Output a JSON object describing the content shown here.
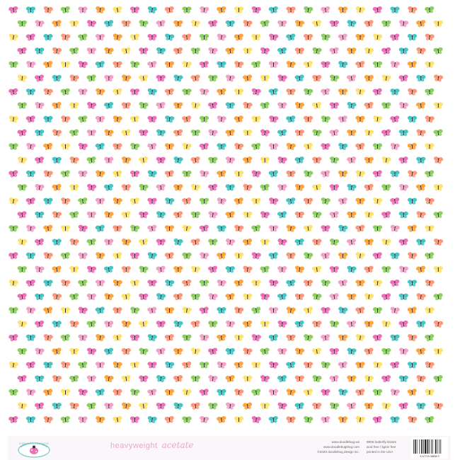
{
  "sheet": {
    "background": "#ffffff",
    "motif": "butterfly",
    "palette": [
      "#ee6fb7",
      "#ffa33b",
      "#8bd05d",
      "#44c6c5",
      "#ffe26a",
      "#f5a0c8",
      "#ff9678"
    ]
  },
  "footer": {
    "brand_name": "DOODLEBUG DESIGN INC",
    "product_prefix": "heavyweight",
    "product_suffix": "acetate",
    "credits": [
      "www.doodlebug.ws",
      "www.doodlebugblog.com",
      "©2020 doodlebug design inc."
    ],
    "info": [
      "8808 butterfly kisses",
      "acid free / lignin free",
      "printed in the USA"
    ],
    "barcode_text": "8 42715 08808 9",
    "accent": "#e9a6c9"
  }
}
